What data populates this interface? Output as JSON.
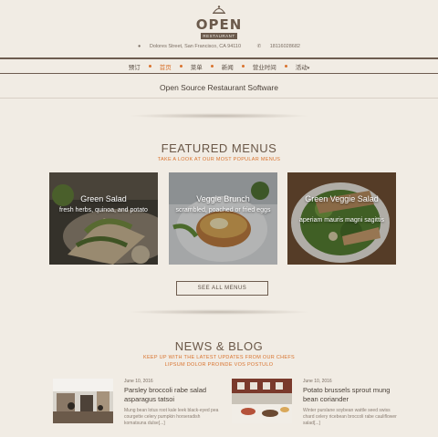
{
  "brand": {
    "name": "OPEN",
    "ribbon": "RESTAURANT"
  },
  "contact": {
    "address": "Dolores Street, San Francisco, CA 94110",
    "phone": "18116028682"
  },
  "nav": {
    "items": [
      {
        "label": "预订"
      },
      {
        "label": "首页",
        "active": true
      },
      {
        "label": "菜单"
      },
      {
        "label": "新闻"
      },
      {
        "label": "营业时间"
      },
      {
        "label": "活动"
      }
    ]
  },
  "tagline": "Open Source Restaurant Software",
  "featured": {
    "title": "FEATURED MENUS",
    "subtitle": "TAKE A LOOK AT OUR MOST POPULAR MENUS",
    "cards": [
      {
        "title": "Green Salad",
        "desc": "fresh herbs, quinoa, and potato"
      },
      {
        "title": "Veggie Brunch",
        "desc": "scrambled, poached or fried eggs"
      },
      {
        "title": "Green Veggie Salad",
        "desc": "aperiam mauris magni sagittis"
      }
    ],
    "see_all": "SEE ALL MENUS"
  },
  "news": {
    "title": "NEWS & BLOG",
    "subtitle_line1": "KEEP UP WITH THE LATEST UPDATES FROM OUR CHEFS",
    "subtitle_line2": "LIPSUM DOLOR PROINDE VOS POSTULO",
    "posts": [
      {
        "date": "June 10, 2016",
        "title": "Parsley broccoli rabe salad asparagus tatsoi",
        "excerpt": "Mung bean lotus root kale leek black-eyed pea courgette celery pumpkin horseradish komatsuna dulse[...]"
      },
      {
        "date": "June 10, 2016",
        "title": "Potato brussels sprout mung bean coriander",
        "excerpt": "Winter purslane soybean wattle seed swiss chard celery ricebean broccoli rabe cauliflower salad[...]"
      }
    ]
  },
  "colors": {
    "accent": "#d9732e",
    "brand": "#6b5a4c",
    "background": "#f1ece4"
  }
}
